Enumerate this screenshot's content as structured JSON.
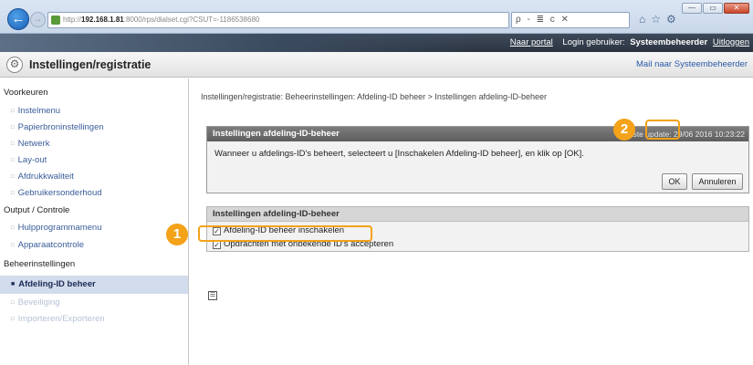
{
  "browser": {
    "address_prefix": "http://",
    "address_host": "192.168.1.81",
    "address_rest": ":8000/rps/dialset.cgi?CSUT=-1186538680",
    "search_text": "ρ - ≣ c ✕",
    "window_buttons": [
      "—",
      "▭",
      "✕"
    ]
  },
  "topbar": {
    "portal_link": "Naar portal",
    "login_label": "Login gebruiker:",
    "user": "Systeembeheerder",
    "logout_link": "Uitloggen"
  },
  "header": {
    "title": "Instellingen/registratie",
    "mail_link": "Mail naar Systeembeheerder"
  },
  "sidebar": {
    "groups": [
      {
        "label": "Voorkeuren",
        "items": [
          "Instelmenu",
          "Papierbroninstellingen",
          "Netwerk",
          "Lay-out",
          "Afdrukkwaliteit",
          "Gebruikersonderhoud"
        ]
      },
      {
        "label": "Output / Controle",
        "items": [
          "Hulpprogrammamenu",
          "Apparaatcontrole"
        ]
      },
      {
        "label": "Beheerinstellingen",
        "items": [
          "Afdeling-ID beheer",
          "Beveiliging",
          "Importeren/Exporteren"
        ]
      }
    ]
  },
  "main": {
    "breadcrumb": "Instellingen/registratie: Beheerinstellingen: Afdeling-ID beheer > Instellingen afdeling-ID-beheer",
    "panel1": {
      "title": "Instellingen afdeling-ID-beheer",
      "last_update": "Laatste update: 29/06 2016 10:23:22",
      "message": "Wanneer u afdelings-ID's beheert, selecteert u [Inschakelen Afdeling-ID beheer], en klik op [OK].",
      "ok_label": "OK",
      "cancel_label": "Annuleren"
    },
    "panel2": {
      "title": "Instellingen afdeling-ID-beheer",
      "checkboxes": [
        {
          "label": "Afdeling-ID beheer inschakelen",
          "checked": true
        },
        {
          "label": "Opdrachten met onbekende ID's accepteren",
          "checked": true
        }
      ]
    }
  },
  "callouts": [
    "1",
    "2"
  ],
  "colors": {
    "accent": "#f4a21a",
    "topbar": "#2b3441",
    "sidebar_active": "#d3dcec"
  }
}
